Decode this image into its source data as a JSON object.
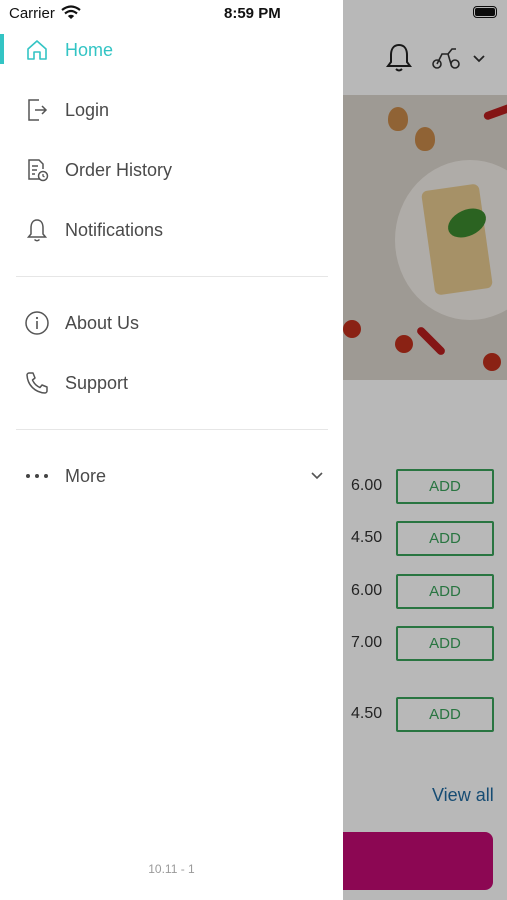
{
  "status_bar": {
    "carrier": "Carrier",
    "time": "8:59 PM"
  },
  "drawer": {
    "items": [
      {
        "label": "Home",
        "icon": "home-icon",
        "active": true
      },
      {
        "label": "Login",
        "icon": "login-icon"
      },
      {
        "label": "Order History",
        "icon": "order-history-icon"
      },
      {
        "label": "Notifications",
        "icon": "bell-icon"
      },
      {
        "label": "About Us",
        "icon": "info-icon"
      },
      {
        "label": "Support",
        "icon": "phone-icon"
      },
      {
        "label": "More",
        "icon": "more-dots-icon"
      }
    ],
    "version": "10.11 - 1",
    "accent_color": "#33c4c4"
  },
  "background": {
    "prices": [
      "6.00",
      "4.50",
      "6.00",
      "7.00",
      "4.50"
    ],
    "add_label": "ADD",
    "view_all": "View all",
    "add_color": "#3aa35b",
    "cta_color": "#c20a74"
  }
}
